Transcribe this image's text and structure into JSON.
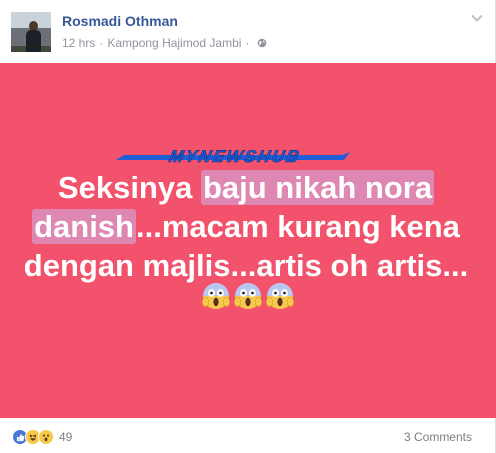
{
  "post": {
    "author": "Rosmadi Othman",
    "time": "12 hrs",
    "separator": "·",
    "location": "Kampong Hajimod Jambi",
    "audience_icon": "globe-icon",
    "menu_icon": "chevron-down-icon"
  },
  "image": {
    "background": "#f2526b",
    "logo_text": "MYNEWSHUB",
    "caption_parts": [
      "Seksinya ",
      "baju nikah nora",
      " ",
      "danish",
      "...macam kurang kena dengan majlis...artis oh artis..."
    ],
    "emoji": [
      "face-screaming-in-fear",
      "face-screaming-in-fear",
      "face-screaming-in-fear"
    ]
  },
  "footer": {
    "reactions": [
      "like",
      "haha",
      "wow"
    ],
    "reaction_count": "49",
    "comments": "3 Comments"
  },
  "colors": {
    "author_link": "#365899",
    "meta": "#90949c",
    "like": "#4a76d6",
    "emoji_yellow": "#f6c94a"
  }
}
